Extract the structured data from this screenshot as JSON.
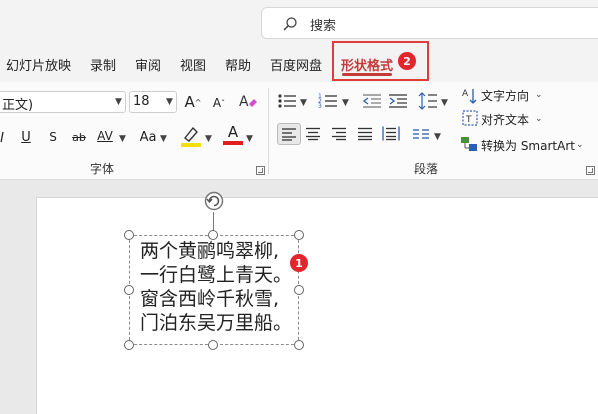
{
  "search": {
    "label": "搜索"
  },
  "tabs": [
    {
      "label": "幻灯片放映"
    },
    {
      "label": "录制"
    },
    {
      "label": "审阅"
    },
    {
      "label": "视图"
    },
    {
      "label": "帮助"
    },
    {
      "label": "百度网盘"
    },
    {
      "label": "形状格式",
      "active": true
    }
  ],
  "annotations": {
    "badge_2": "2",
    "badge_1": "1"
  },
  "font_group": {
    "label": "字体",
    "font_name": "正文)",
    "font_size": "18",
    "grow_label": "A",
    "shrink_label": "A",
    "underline_label": "U",
    "strike_label": "ab",
    "spacing_label": "AV",
    "case_label": "Aa",
    "font_color_label": "A",
    "highlight_color": "#f0e10a",
    "font_color": "#e0201f"
  },
  "paragraph_group": {
    "label": "段落",
    "text_direction": "文字方向",
    "align_text": "对齐文本",
    "smartart": "转换为 SmartArt"
  },
  "slide": {
    "poem_lines": [
      "两个黄鹂鸣翠柳,",
      "一行白鹭上青天。",
      "窗含西岭千秋雪,",
      "门泊东吴万里船。"
    ]
  },
  "colors": {
    "accent": "#c43a3a",
    "highlight_box": "#e03c3c",
    "badge": "#e2262d"
  }
}
